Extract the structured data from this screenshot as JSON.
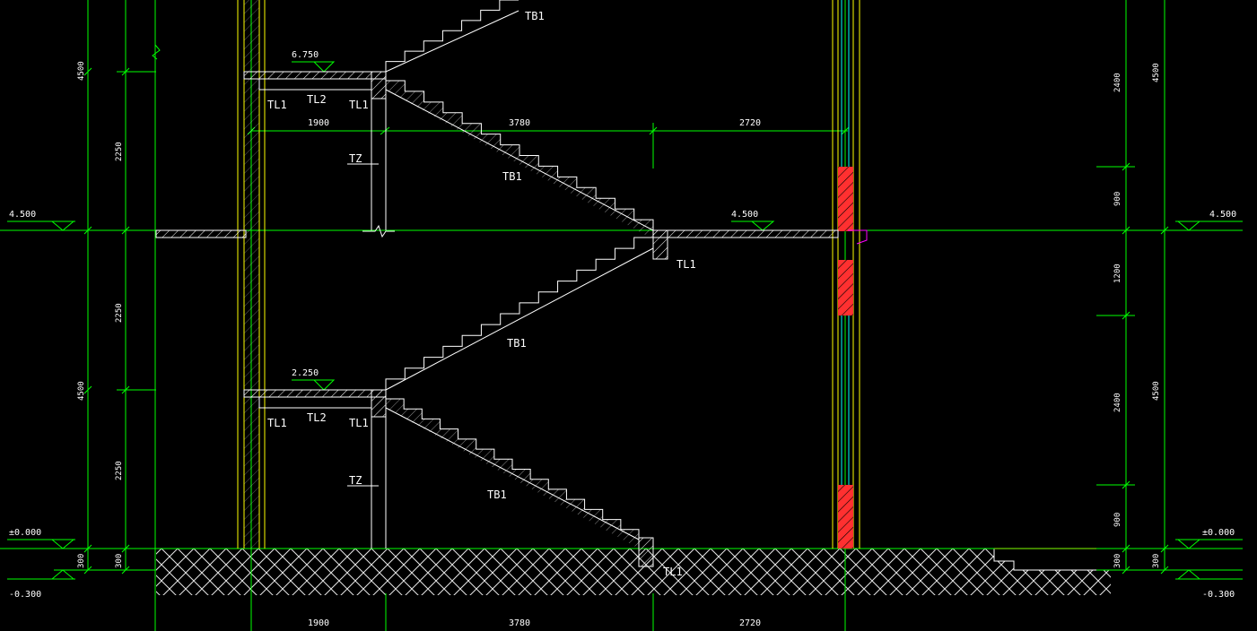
{
  "colors": {
    "background": "#000000",
    "dimension": "#00ff00",
    "wall": "#ffff00",
    "outline": "#ffffff",
    "axis_red": "#ff0000",
    "section_fill": "#ff4040",
    "glass": "#00ffff",
    "marker": "#ff00ff"
  },
  "elevations": {
    "level_4500_left": "4.500",
    "level_4500_right": "4.500",
    "level_4500_landing": "4.500",
    "ground_left": "±0.000",
    "ground_right": "±0.000",
    "below_left": "-0.300",
    "below_right": "-0.300",
    "landing_upper": "6.750",
    "landing_lower": "2.250"
  },
  "labels": {
    "tb1_top": "TB1",
    "tb1_upper_down": "TB1",
    "tb1_mid_up": "TB1",
    "tb1_lower_down": "TB1",
    "tl1_upper_left": "TL1",
    "tl2_upper": "TL2",
    "tl1_upper_right": "TL1",
    "tl1_mid": "TL1",
    "tl1_lower_left": "TL1",
    "tl2_lower": "TL2",
    "tl1_lower_right": "TL1",
    "tl1_bottom": "TL1",
    "tz_upper": "TZ",
    "tz_lower": "TZ"
  },
  "dimensions": {
    "left_outer": [
      "4500",
      "4500",
      "300"
    ],
    "left_inner": [
      "2250",
      "2250",
      "2250",
      "300"
    ],
    "right_outer": [
      "4500",
      "4500",
      "300"
    ],
    "right_inner": [
      "2400",
      "900",
      "1200",
      "2400",
      "900",
      "300"
    ],
    "horizontal_mid": [
      "1900",
      "3780",
      "2720"
    ],
    "horizontal_bottom": [
      "1900",
      "3780",
      "2720"
    ]
  }
}
